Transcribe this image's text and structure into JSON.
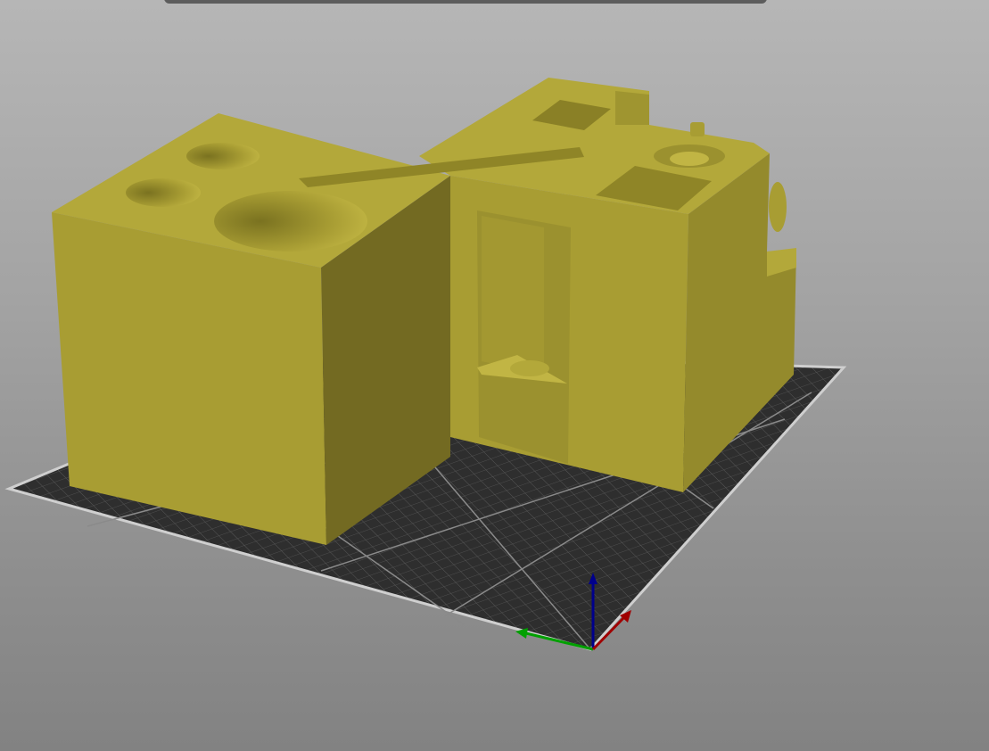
{
  "app": {
    "view": "3D viewport",
    "object_color": "#b3a83a",
    "bed_color": "#2e2e2e",
    "bed_grid_color": "#555555",
    "bed_border_color": "#cfcfcf",
    "axes": {
      "x_color": "#a00000",
      "y_color": "#00a000",
      "z_color": "#00008c"
    }
  }
}
